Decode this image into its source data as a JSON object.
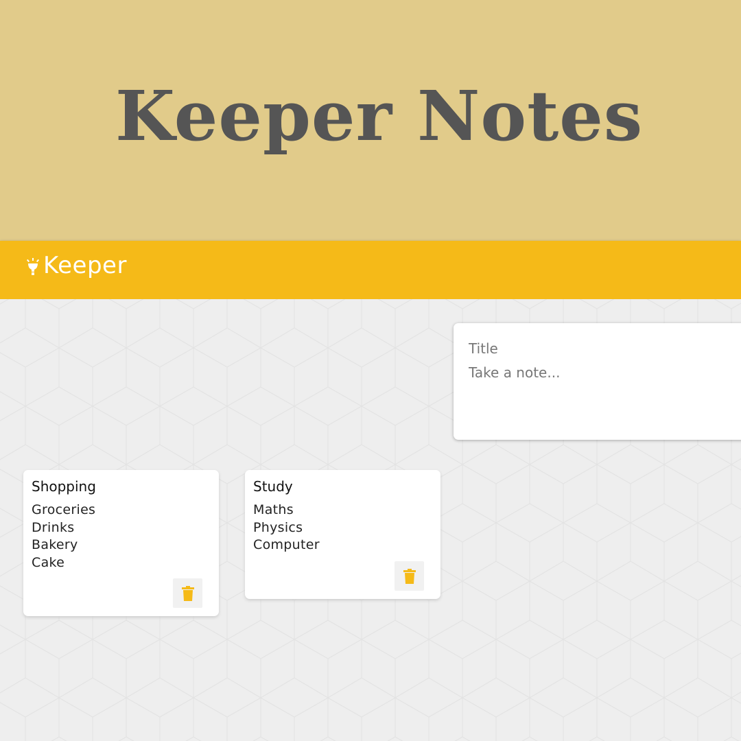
{
  "hero": {
    "title": "Keeper Notes"
  },
  "header": {
    "brand": "Keeper",
    "brand_icon": "lightbulb-icon"
  },
  "compose": {
    "title_placeholder": "Title",
    "content_placeholder": "Take a note..."
  },
  "notes": [
    {
      "title": "Shopping",
      "lines": [
        "Groceries",
        "Drinks",
        "Bakery",
        "Cake"
      ],
      "delete_icon": "trash-icon"
    },
    {
      "title": "Study",
      "lines": [
        "Maths",
        "Physics",
        "Computer"
      ],
      "delete_icon": "trash-icon"
    }
  ],
  "colors": {
    "hero_bg": "#e1cb8a",
    "accent": "#f5ba18",
    "workspace_bg": "#eeeeee",
    "hero_text": "#555555"
  }
}
